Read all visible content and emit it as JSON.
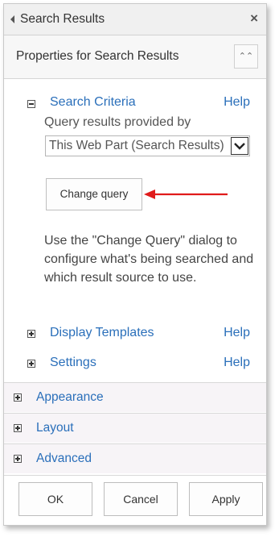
{
  "titlebar": {
    "title": "Search Results",
    "close_icon": "×"
  },
  "properties": {
    "title": "Properties for Search Results",
    "collapse_icon": "⌃⌃"
  },
  "search_criteria": {
    "label": "Search Criteria",
    "help": "Help",
    "query_label": "Query results provided by",
    "source_value": "This Web Part (Search Results)",
    "change_query_label": "Change query",
    "description": "Use the \"Change Query\" dialog to configure what's being searched and which result source to use."
  },
  "display_templates": {
    "label": "Display Templates",
    "help": "Help"
  },
  "settings": {
    "label": "Settings",
    "help": "Help"
  },
  "panels": [
    {
      "label": "Appearance"
    },
    {
      "label": "Layout"
    },
    {
      "label": "Advanced"
    }
  ],
  "footer": {
    "ok": "OK",
    "cancel": "Cancel",
    "apply": "Apply"
  },
  "colors": {
    "link": "#2a6fba",
    "annotation_arrow": "#e01b1b"
  }
}
